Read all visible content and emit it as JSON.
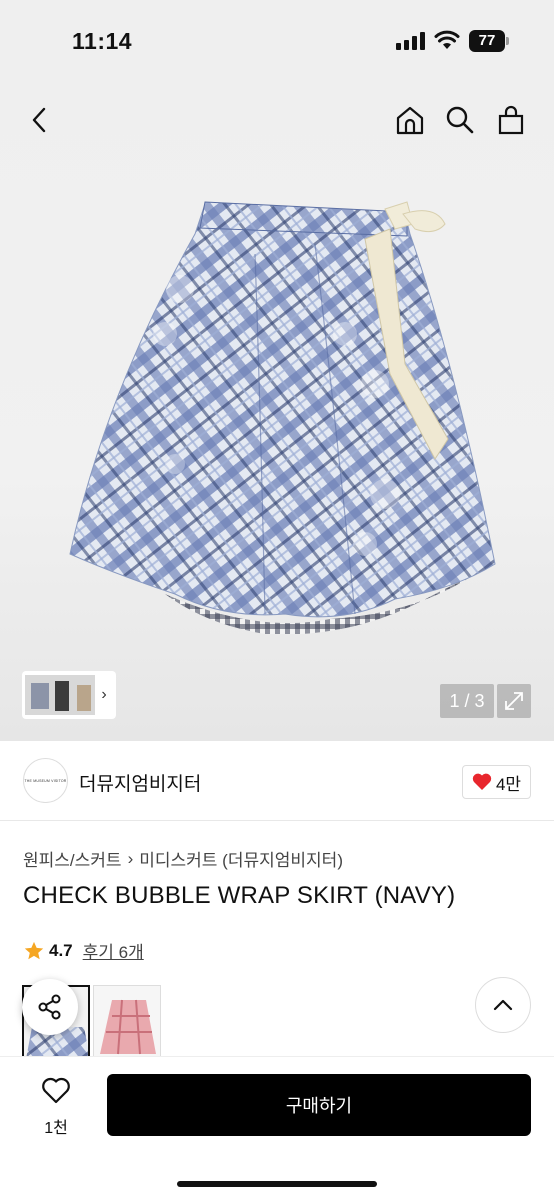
{
  "status": {
    "time": "11:14",
    "battery": "77"
  },
  "gallery": {
    "pager": "1 / 3"
  },
  "brand": {
    "name": "더뮤지엄비지터",
    "logo_text": "THE MUSEUM VISITOR",
    "likes": "4만"
  },
  "breadcrumb": {
    "category": "원피스/스커트",
    "separator": "›",
    "subcategory": "미디스커트 (더뮤지엄비지터)"
  },
  "product": {
    "title": "CHECK BUBBLE WRAP SKIRT (NAVY)",
    "rating": "4.7",
    "reviews": "후기 6개"
  },
  "bottom": {
    "wish_count": "1천",
    "buy_label": "구매하기"
  },
  "colors": {
    "accent": "#000000",
    "heart": "#e8262d",
    "star": "#f5a623",
    "plaid_blue": "#6f83b8"
  }
}
